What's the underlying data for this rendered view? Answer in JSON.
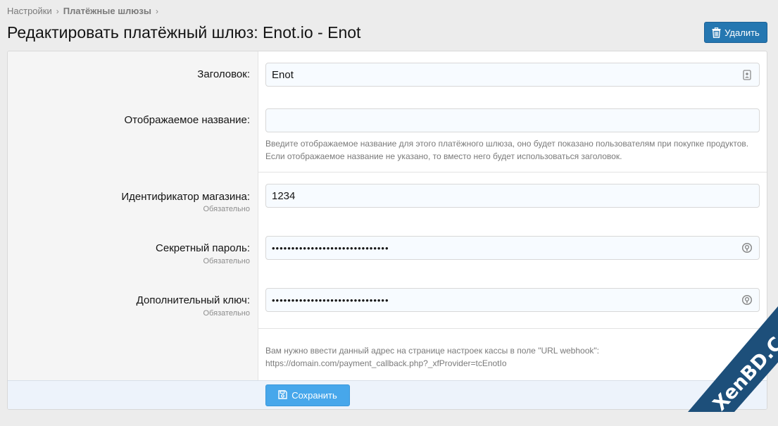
{
  "breadcrumb": {
    "items": [
      "Настройки",
      "Платёжные шлюзы"
    ],
    "separator": "›"
  },
  "page": {
    "title": "Редактировать платёжный шлюз: Enot.io - Enot"
  },
  "toolbar": {
    "delete_label": "Удалить",
    "delete_icon": "trash-icon"
  },
  "form": {
    "title_field": {
      "label": "Заголовок:",
      "value": "Enot",
      "icon": "contact-card-icon"
    },
    "display_name_field": {
      "label": "Отображаемое название:",
      "value": "",
      "explain": "Введите отображаемое название для этого платёжного шлюза, оно будет показано пользователям при покупке продуктов. Если отображаемое название не указано, то вместо него будет использоваться заголовок."
    },
    "shop_id_field": {
      "label": "Идентификатор магазина:",
      "hint": "Обязательно",
      "value": "1234"
    },
    "secret_password_field": {
      "label": "Секретный пароль:",
      "hint": "Обязательно",
      "value": "••••••••••••••••••••••••••••••",
      "icon": "password-toggle-icon"
    },
    "extra_key_field": {
      "label": "Дополнительный ключ:",
      "hint": "Обязательно",
      "value": "••••••••••••••••••••••••••••••",
      "icon": "password-toggle-icon"
    },
    "webhook_note": {
      "line1": "Вам нужно ввести данный адрес на странице настроек кассы в поле \"URL webhook\":",
      "line2": "https://domain.com/payment_callback.php?_xfProvider=tcEnotIo"
    },
    "save_label": "Сохранить",
    "save_icon": "floppy-disk-icon"
  },
  "watermark": {
    "text": "XenBD.Com"
  },
  "colors": {
    "primary": "#2577b1",
    "save": "#47a7eb",
    "watermark_band": "#1d4f7a"
  }
}
